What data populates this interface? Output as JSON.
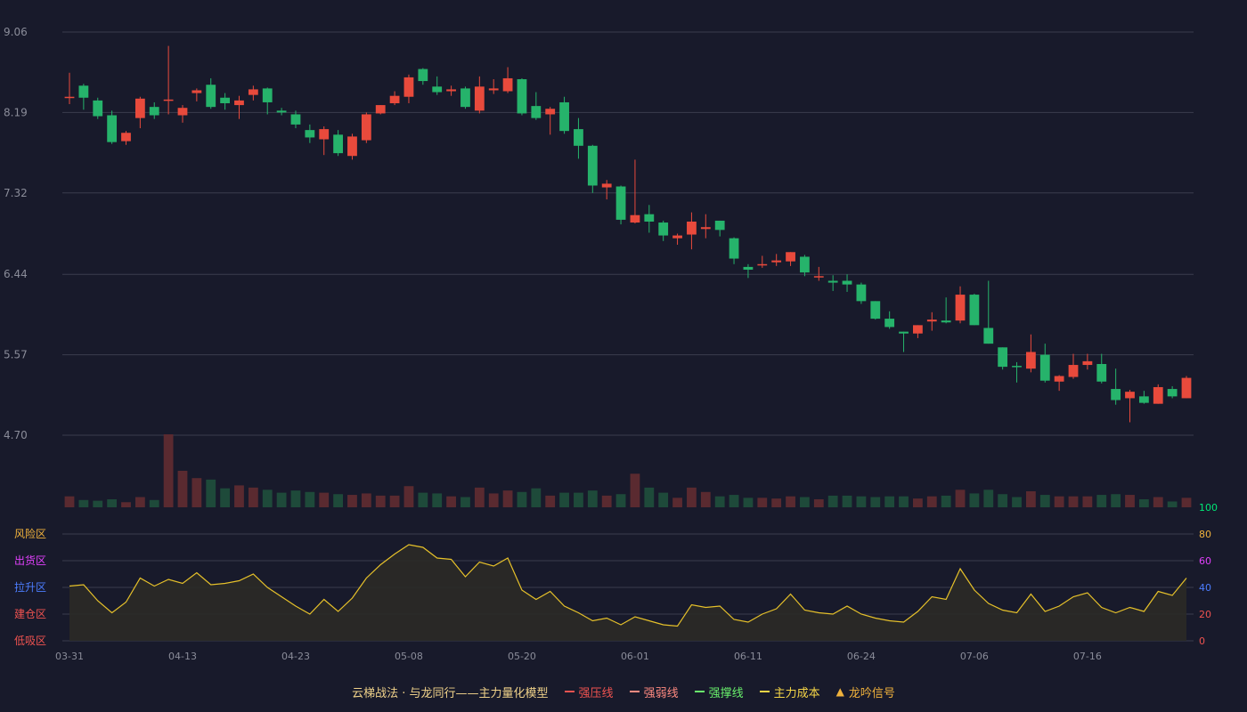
{
  "chart_data": {
    "type": "candlestick",
    "price_ticks": [
      "9.06",
      "8.19",
      "7.32",
      "6.44",
      "5.57",
      "4.70"
    ],
    "x_tick_labels": [
      {
        "i": 0,
        "label": "03-31"
      },
      {
        "i": 8,
        "label": "04-13"
      },
      {
        "i": 16,
        "label": "04-23"
      },
      {
        "i": 24,
        "label": "05-08"
      },
      {
        "i": 32,
        "label": "05-20"
      },
      {
        "i": 40,
        "label": "06-01"
      },
      {
        "i": 48,
        "label": "06-11"
      },
      {
        "i": 56,
        "label": "06-24"
      },
      {
        "i": 64,
        "label": "07-06"
      },
      {
        "i": 72,
        "label": "07-16"
      }
    ],
    "zone_labels": [
      {
        "label": "风险区",
        "value": 80,
        "color": "#f0b23c"
      },
      {
        "label": "出货区",
        "value": 60,
        "color": "#e040fb"
      },
      {
        "label": "拉升区",
        "value": 40,
        "color": "#4c7dff"
      },
      {
        "label": "建仓区",
        "value": 20,
        "color": "#ef5350"
      },
      {
        "label": "低吸区",
        "value": 0,
        "color": "#ef5350"
      }
    ],
    "indicator_ticks": [
      {
        "value": 100,
        "label": "100",
        "color": "#00e676"
      },
      {
        "value": 80,
        "label": "80",
        "color": "#f0b23c"
      },
      {
        "value": 60,
        "label": "60",
        "color": "#e040fb"
      },
      {
        "value": 40,
        "label": "40",
        "color": "#4c7dff"
      },
      {
        "value": 20,
        "label": "20",
        "color": "#ef5350"
      },
      {
        "value": 0,
        "label": "0",
        "color": "#ef5350"
      }
    ],
    "colors": {
      "up": "#e84a3c",
      "down": "#26b36b",
      "up_volume": "#5a2a30",
      "down_volume": "#1e4a3a",
      "indicator_line": "#e6c12a",
      "indicator_fill": "#2b2a26",
      "grid": "#3a3c4e",
      "axis_text": "#8a8c99"
    },
    "candles": [
      [
        8.35,
        8.36,
        8.28,
        8.62
      ],
      [
        8.48,
        8.35,
        8.22,
        8.5
      ],
      [
        8.32,
        8.15,
        8.12,
        8.35
      ],
      [
        8.16,
        7.87,
        7.85,
        8.21
      ],
      [
        7.88,
        7.97,
        7.84,
        7.99
      ],
      [
        8.13,
        8.34,
        8.02,
        8.36
      ],
      [
        8.25,
        8.16,
        8.12,
        8.3
      ],
      [
        8.32,
        8.33,
        8.17,
        8.91
      ],
      [
        8.16,
        8.24,
        8.08,
        8.27
      ],
      [
        8.4,
        8.43,
        8.31,
        8.45
      ],
      [
        8.49,
        8.25,
        8.23,
        8.56
      ],
      [
        8.35,
        8.29,
        8.22,
        8.4
      ],
      [
        8.27,
        8.32,
        8.12,
        8.37
      ],
      [
        8.38,
        8.44,
        8.32,
        8.48
      ],
      [
        8.45,
        8.3,
        8.17,
        8.46
      ],
      [
        8.21,
        8.19,
        8.16,
        8.24
      ],
      [
        8.17,
        8.06,
        8.02,
        8.21
      ],
      [
        8.0,
        7.92,
        7.86,
        8.06
      ],
      [
        7.9,
        8.01,
        7.73,
        8.04
      ],
      [
        7.95,
        7.75,
        7.72,
        8.0
      ],
      [
        7.72,
        7.93,
        7.68,
        7.96
      ],
      [
        7.89,
        8.17,
        7.86,
        8.19
      ],
      [
        8.18,
        8.27,
        8.17,
        8.27
      ],
      [
        8.29,
        8.37,
        8.27,
        8.42
      ],
      [
        8.36,
        8.57,
        8.29,
        8.6
      ],
      [
        8.66,
        8.53,
        8.49,
        8.67
      ],
      [
        8.47,
        8.41,
        8.38,
        8.58
      ],
      [
        8.42,
        8.44,
        8.37,
        8.48
      ],
      [
        8.45,
        8.25,
        8.23,
        8.47
      ],
      [
        8.21,
        8.47,
        8.18,
        8.58
      ],
      [
        8.43,
        8.45,
        8.39,
        8.55
      ],
      [
        8.42,
        8.56,
        8.4,
        8.68
      ],
      [
        8.55,
        8.18,
        8.16,
        8.56
      ],
      [
        8.26,
        8.13,
        8.11,
        8.41
      ],
      [
        8.17,
        8.23,
        7.95,
        8.25
      ],
      [
        8.3,
        7.99,
        7.96,
        8.36
      ],
      [
        8.01,
        7.83,
        7.69,
        8.13
      ],
      [
        7.83,
        7.4,
        7.32,
        7.84
      ],
      [
        7.38,
        7.42,
        7.25,
        7.46
      ],
      [
        7.39,
        7.03,
        6.98,
        7.4
      ],
      [
        7.0,
        7.08,
        6.99,
        7.68
      ],
      [
        7.09,
        7.01,
        6.89,
        7.19
      ],
      [
        7.0,
        6.86,
        6.8,
        7.02
      ],
      [
        6.83,
        6.86,
        6.76,
        6.88
      ],
      [
        6.87,
        7.01,
        6.71,
        7.11
      ],
      [
        6.93,
        6.95,
        6.83,
        7.09
      ],
      [
        7.02,
        6.92,
        6.85,
        7.02
      ],
      [
        6.83,
        6.61,
        6.55,
        6.84
      ],
      [
        6.52,
        6.49,
        6.4,
        6.55
      ],
      [
        6.55,
        6.55,
        6.51,
        6.64
      ],
      [
        6.57,
        6.59,
        6.53,
        6.66
      ],
      [
        6.58,
        6.68,
        6.53,
        6.68
      ],
      [
        6.63,
        6.46,
        6.42,
        6.65
      ],
      [
        6.42,
        6.42,
        6.37,
        6.52
      ],
      [
        6.37,
        6.35,
        6.26,
        6.43
      ],
      [
        6.37,
        6.33,
        6.25,
        6.44
      ],
      [
        6.33,
        6.15,
        6.12,
        6.35
      ],
      [
        6.15,
        5.96,
        5.95,
        6.15
      ],
      [
        5.96,
        5.87,
        5.85,
        6.04
      ],
      [
        5.82,
        5.8,
        5.6,
        5.82
      ],
      [
        5.8,
        5.89,
        5.75,
        5.89
      ],
      [
        5.93,
        5.95,
        5.83,
        6.03
      ],
      [
        5.94,
        5.92,
        5.91,
        6.19
      ],
      [
        5.94,
        6.22,
        5.91,
        6.31
      ],
      [
        6.22,
        5.89,
        5.89,
        6.23
      ],
      [
        5.86,
        5.69,
        5.69,
        6.37
      ],
      [
        5.65,
        5.44,
        5.41,
        5.65
      ],
      [
        5.45,
        5.44,
        5.27,
        5.49
      ],
      [
        5.42,
        5.6,
        5.38,
        5.79
      ],
      [
        5.57,
        5.29,
        5.27,
        5.69
      ],
      [
        5.28,
        5.34,
        5.18,
        5.35
      ],
      [
        5.33,
        5.46,
        5.31,
        5.58
      ],
      [
        5.46,
        5.5,
        5.41,
        5.58
      ],
      [
        5.47,
        5.28,
        5.26,
        5.58
      ],
      [
        5.2,
        5.08,
        5.03,
        5.42
      ],
      [
        5.1,
        5.17,
        4.84,
        5.19
      ],
      [
        5.12,
        5.05,
        5.04,
        5.18
      ],
      [
        5.04,
        5.22,
        5.04,
        5.25
      ],
      [
        5.2,
        5.12,
        5.1,
        5.23
      ],
      [
        5.1,
        5.32,
        5.1,
        5.34
      ]
    ],
    "volume": [
      15,
      10,
      9,
      11,
      7,
      14,
      10,
      100,
      50,
      40,
      38,
      26,
      30,
      27,
      24,
      20,
      23,
      21,
      20,
      18,
      17,
      19,
      16,
      16,
      29,
      20,
      19,
      15,
      14,
      27,
      19,
      23,
      21,
      26,
      16,
      20,
      20,
      23,
      16,
      18,
      46,
      27,
      20,
      13,
      27,
      21,
      15,
      17,
      13,
      13,
      12,
      15,
      14,
      11,
      16,
      16,
      15,
      14,
      15,
      15,
      12,
      15,
      16,
      24,
      19,
      24,
      18,
      14,
      22,
      17,
      15,
      15,
      15,
      17,
      18,
      17,
      11,
      14,
      8,
      13
    ],
    "indicator": [
      41,
      42,
      30,
      21,
      29,
      47,
      41,
      46,
      43,
      51,
      42,
      43,
      45,
      50,
      40,
      33,
      26,
      20,
      31,
      22,
      32,
      47,
      57,
      65,
      72,
      70,
      62,
      61,
      48,
      59,
      56,
      62,
      38,
      31,
      37,
      26,
      21,
      15,
      17,
      12,
      18,
      15,
      12,
      11,
      27,
      25,
      26,
      16,
      14,
      20,
      24,
      35,
      23,
      21,
      20,
      26,
      20,
      17,
      15,
      14,
      22,
      33,
      31,
      54,
      38,
      28,
      23,
      21,
      35,
      22,
      26,
      33,
      36,
      25,
      21,
      25,
      22,
      37,
      34,
      47
    ]
  },
  "legend": {
    "title": "云梯战法 · 与龙同行——主力量化模型",
    "items": [
      {
        "label": "强压线",
        "color": "#ef5350",
        "style": "solid"
      },
      {
        "label": "强弱线",
        "color": "#ff8a80",
        "style": "dashed"
      },
      {
        "label": "强撑线",
        "color": "#69f06c",
        "style": "solid"
      },
      {
        "label": "主力成本",
        "color": "#f5d547",
        "style": "dashed"
      },
      {
        "label": "龙吟信号",
        "color": "#f0b23c",
        "style": "triangle"
      }
    ]
  }
}
